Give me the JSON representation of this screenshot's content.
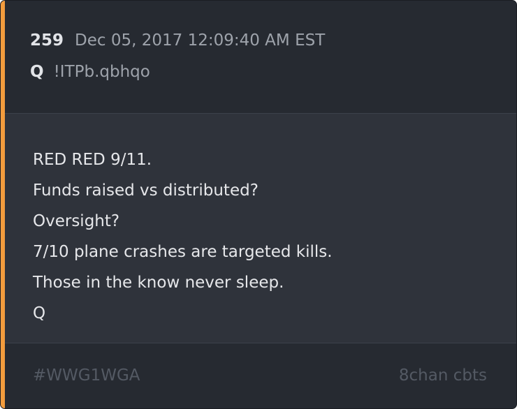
{
  "post": {
    "number": "259",
    "date": "Dec 05, 2017 12:09:40 AM EST",
    "author": "Q",
    "tripcode": "!ITPb.qbhqo"
  },
  "body": {
    "lines": [
      "RED RED 9/11.",
      "Funds raised vs distributed?",
      "Oversight?",
      "7/10 plane crashes are targeted kills.",
      "Those in the know never sleep.",
      "Q"
    ]
  },
  "footer": {
    "hashtag": "#WWG1WGA",
    "source": "8chan cbts"
  },
  "colors": {
    "accent": "#f39c3d",
    "card_background": "#2f333b",
    "header_background": "#262a31"
  }
}
